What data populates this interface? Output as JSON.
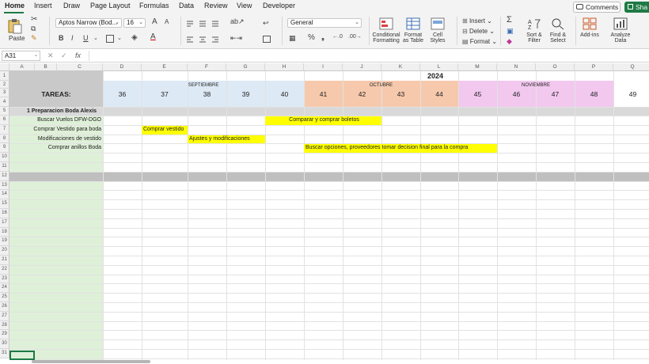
{
  "menu": {
    "tabs": [
      "Home",
      "Insert",
      "Draw",
      "Page Layout",
      "Formulas",
      "Data",
      "Review",
      "View",
      "Developer"
    ],
    "comments": "Comments",
    "share": "Sha"
  },
  "ribbon": {
    "paste": "Paste",
    "font_name": "Aptos Narrow (Bod...",
    "font_size": "16",
    "number_format": "General",
    "conditional_formatting": [
      "Conditional",
      "Formatting"
    ],
    "format_as_table": [
      "Format",
      "as Table"
    ],
    "cell_styles": [
      "Cell",
      "Styles"
    ],
    "insert": "Insert",
    "delete": "Delete",
    "format": "Format",
    "sort_filter": [
      "Sort &",
      "Filter"
    ],
    "find_select": [
      "Find &",
      "Select"
    ],
    "add_ins": "Add-ins",
    "analyze_data": [
      "Analyze",
      "Data"
    ],
    "bold": "B",
    "italic": "I",
    "underline": "U",
    "grow_font": "A",
    "shrink_font": "A"
  },
  "formula_bar": {
    "name_box": "A31",
    "fx": "fx"
  },
  "columns": [
    "A",
    "B",
    "C",
    "D",
    "E",
    "F",
    "G",
    "H",
    "I",
    "J",
    "K",
    "L",
    "M",
    "N",
    "O",
    "P",
    "Q"
  ],
  "rows": [
    "1",
    "2",
    "3",
    "4",
    "5",
    "6",
    "7",
    "8",
    "9",
    "10",
    "11",
    "12",
    "13",
    "14",
    "15",
    "16",
    "17",
    "18",
    "19",
    "20",
    "21",
    "22",
    "23",
    "24",
    "25",
    "26",
    "27",
    "28",
    "29",
    "30",
    "31"
  ],
  "sheet": {
    "year": "2024",
    "tareas": "TAREAS:",
    "months": {
      "sep": "SEPTIEMBRE",
      "oct": "OCTUBRE",
      "nov": "NOVIEMBRE"
    },
    "weeks": [
      "36",
      "37",
      "38",
      "39",
      "40",
      "41",
      "42",
      "43",
      "44",
      "45",
      "46",
      "47",
      "48",
      "49"
    ],
    "section_title": "1  Preparacion Boda Alexis",
    "tasks": [
      {
        "name": "Buscar Vuelos DFW-DGO",
        "bar_text": "Comparar y comprar boletos"
      },
      {
        "name": "Comprar Vestido para boda",
        "bar_text": "Comprar vestido"
      },
      {
        "name": "Modificaciones de vestido",
        "bar_text": "Ajustes y modificaciones"
      },
      {
        "name": "Comprar anillos Boda",
        "bar_text": "Buscar opciones, proveedores tomar decision final para la compra"
      }
    ]
  },
  "colors": {
    "task_col": "#dff0d8",
    "sep_fill": "#dde9f5",
    "oct_fill": "#f6c9ad",
    "nov_fill": "#f2c8ef",
    "bar_fill": "#ffff00",
    "band_fill": "#bfbfbf",
    "accent": "#1e7a45"
  }
}
